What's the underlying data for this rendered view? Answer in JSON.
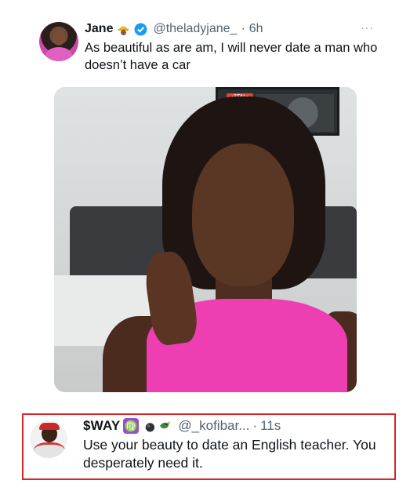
{
  "tweet": {
    "author_name": "Jane",
    "handle": "@theladyjane_",
    "separator": "·",
    "time": "6h",
    "more_label": "···",
    "text": "As beautiful as are am, I will never date a man who doesn’t have a car",
    "photo_plate_text": "-2TAL-"
  },
  "reply": {
    "author_name": "$WAY",
    "zodiac_glyph": "♍",
    "handle": "@_kofibar...",
    "separator": "·",
    "time": "11s",
    "text": "Use your beauty to date an English teacher. You desperately need it."
  },
  "colors": {
    "verified_badge": "#1d9bf0",
    "reply_highlight_border": "#d9242c",
    "muted_text": "#536471"
  }
}
